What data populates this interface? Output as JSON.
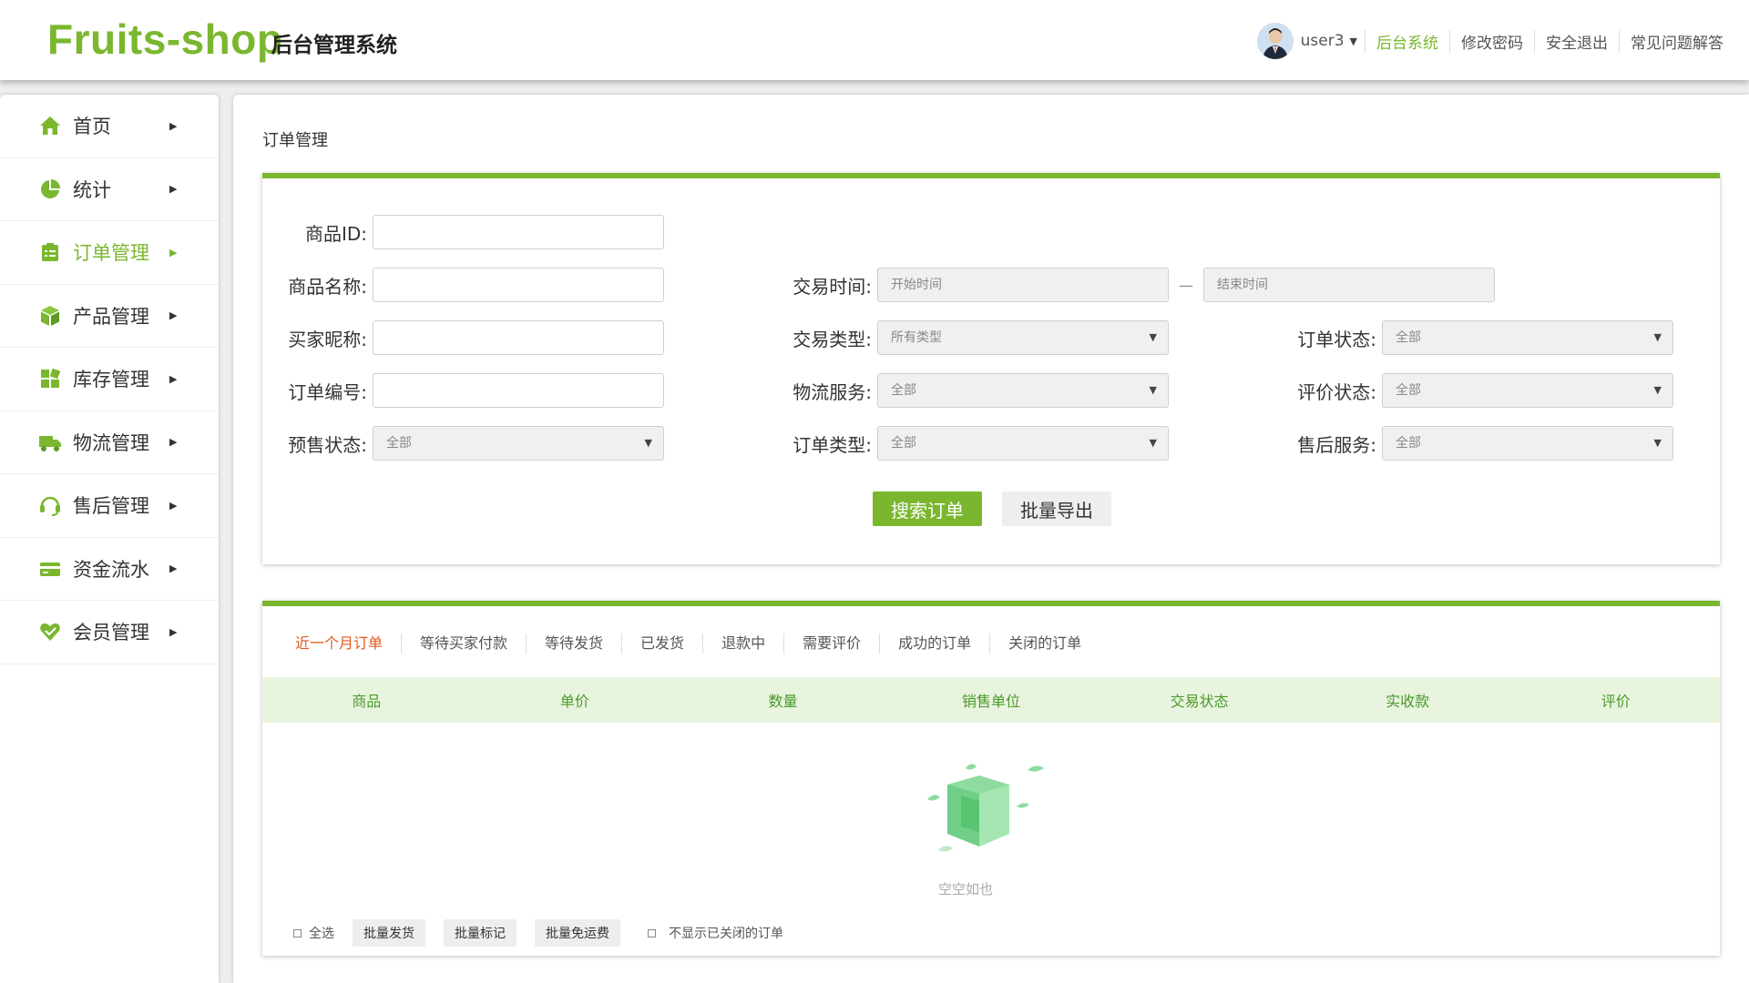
{
  "header": {
    "logo": "Fruits-shop",
    "subtitle": "后台管理系统",
    "username": "user3",
    "links": [
      "后台系统",
      "修改密码",
      "安全退出",
      "常见问题解答"
    ]
  },
  "sidebar": {
    "items": [
      {
        "label": "首页",
        "icon": "home-icon"
      },
      {
        "label": "统计",
        "icon": "pie-chart-icon"
      },
      {
        "label": "订单管理",
        "icon": "clipboard-icon"
      },
      {
        "label": "产品管理",
        "icon": "cube-icon"
      },
      {
        "label": "库存管理",
        "icon": "grid-icon"
      },
      {
        "label": "物流管理",
        "icon": "truck-icon"
      },
      {
        "label": "售后管理",
        "icon": "headset-icon"
      },
      {
        "label": "资金流水",
        "icon": "card-icon"
      },
      {
        "label": "会员管理",
        "icon": "heart-shield-icon"
      }
    ],
    "active_index": 2
  },
  "page": {
    "title": "订单管理"
  },
  "form": {
    "product_id": "商品ID:",
    "product_name": "商品名称:",
    "buyer_nickname": "买家昵称:",
    "order_number": "订单编号:",
    "presale_status": "预售状态:",
    "presale_status_value": "全部",
    "trade_time": "交易时间:",
    "start_time_placeholder": "开始时间",
    "end_time_placeholder": "结束时间",
    "trade_type": "交易类型:",
    "trade_type_value": "所有类型",
    "logistics": "物流服务:",
    "logistics_value": "全部",
    "order_type": "订单类型:",
    "order_type_value": "全部",
    "order_status": "订单状态:",
    "order_status_value": "全部",
    "review_status": "评价状态:",
    "review_status_value": "全部",
    "after_sales": "售后服务:",
    "after_sales_value": "全部",
    "search_button": "搜索订单",
    "export_button": "批量导出"
  },
  "orders": {
    "tabs": [
      "近一个月订单",
      "等待买家付款",
      "等待发货",
      "已发货",
      "退款中",
      "需要评价",
      "成功的订单",
      "关闭的订单"
    ],
    "active_tab": 0,
    "columns": [
      "商品",
      "单价",
      "数量",
      "销售单位",
      "交易状态",
      "实收款",
      "评价"
    ],
    "empty_text": "空空如也",
    "select_all": "全选",
    "batch_ship": "批量发货",
    "batch_mark": "批量标记",
    "batch_free_shipping": "批量免运费",
    "hide_closed": "不显示已关闭的订单"
  },
  "colors": {
    "accent": "#7ab72f",
    "active_tab": "#e05a1c",
    "table_header_bg": "#e9f4df"
  }
}
